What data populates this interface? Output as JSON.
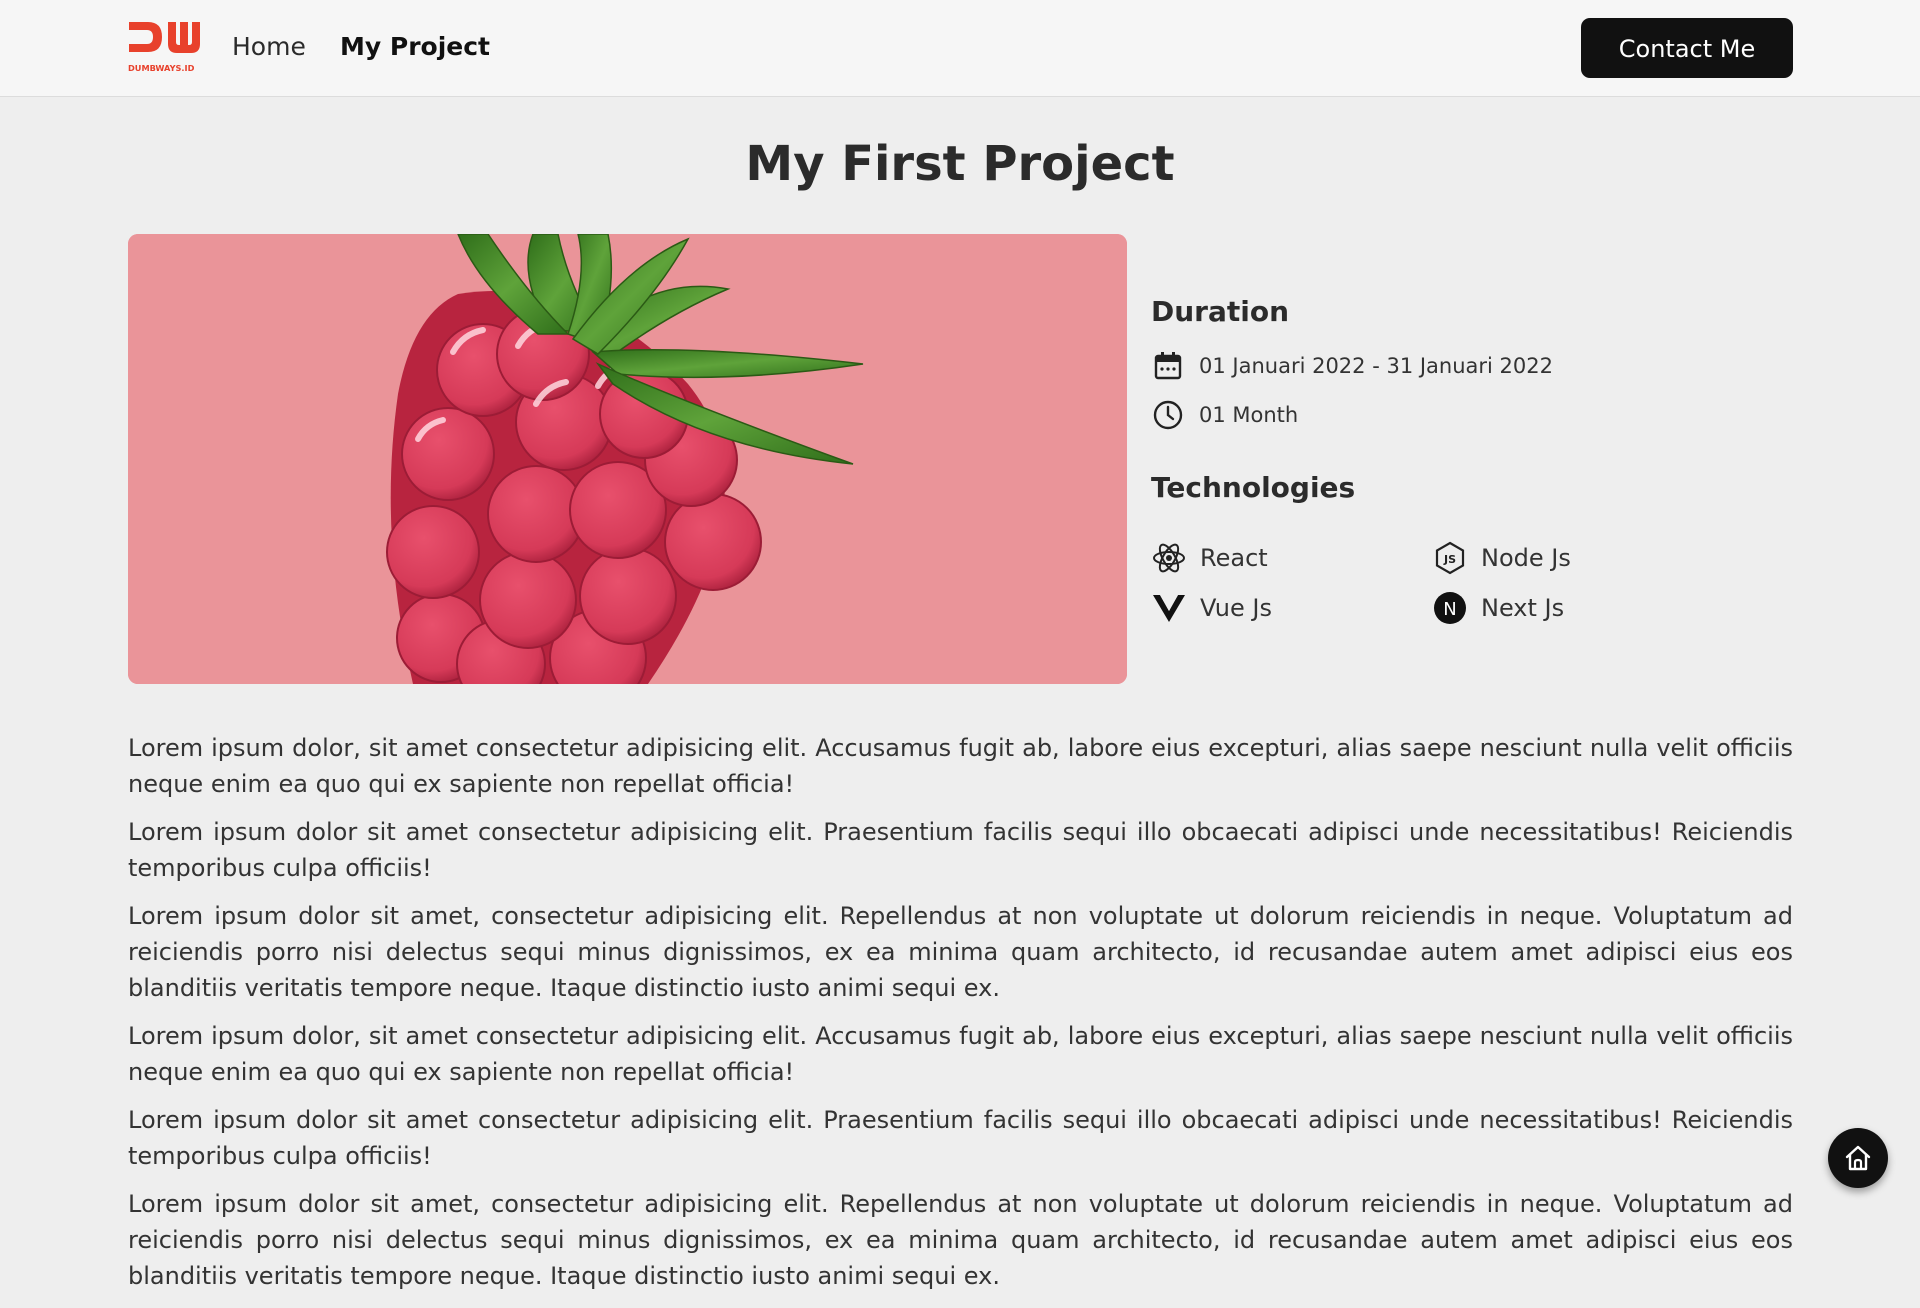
{
  "navbar": {
    "logo_text": "DUMBWAYS.ID",
    "links": [
      {
        "label": "Home",
        "active": false
      },
      {
        "label": "My Project",
        "active": true
      }
    ],
    "contact_button": "Contact Me"
  },
  "page": {
    "title": "My First Project"
  },
  "project": {
    "image": "raspberry-illustration",
    "duration_heading": "Duration",
    "date_range": "01 Januari 2022 - 31 Januari 2022",
    "length": "01 Month",
    "technologies_heading": "Technologies",
    "technologies": [
      {
        "name": "React",
        "icon": "react-icon"
      },
      {
        "name": "Node Js",
        "icon": "nodejs-icon"
      },
      {
        "name": "Vue Js",
        "icon": "vue-icon"
      },
      {
        "name": "Next Js",
        "icon": "nextjs-icon"
      }
    ]
  },
  "description": [
    "Lorem ipsum dolor, sit amet consectetur adipisicing elit. Accusamus fugit ab, labore eius excepturi, alias saepe nesciunt nulla velit officiis neque enim ea quo qui ex sapiente non repellat officia!",
    "Lorem ipsum dolor sit amet consectetur adipisicing elit. Praesentium facilis sequi illo obcaecati adipisci unde necessitatibus! Reiciendis temporibus culpa officiis!",
    "Lorem ipsum dolor sit amet, consectetur adipisicing elit. Repellendus at non voluptate ut dolorum reiciendis in neque. Voluptatum ad reiciendis porro nisi delectus sequi minus dignissimos, ex ea minima quam architecto, id recusandae autem amet adipisci eius eos blanditiis veritatis tempore neque. Itaque distinctio iusto animi sequi ex.",
    "Lorem ipsum dolor, sit amet consectetur adipisicing elit. Accusamus fugit ab, labore eius excepturi, alias saepe nesciunt nulla velit officiis neque enim ea quo qui ex sapiente non repellat officia!",
    "Lorem ipsum dolor sit amet consectetur adipisicing elit. Praesentium facilis sequi illo obcaecati adipisci unde necessitatibus! Reiciendis temporibus culpa officiis!",
    "Lorem ipsum dolor sit amet, consectetur adipisicing elit. Repellendus at non voluptate ut dolorum reiciendis in neque. Voluptatum ad reiciendis porro nisi delectus sequi minus dignissimos, ex ea minima quam architecto, id recusandae autem amet adipisci eius eos blanditiis veritatis tempore neque. Itaque distinctio iusto animi sequi ex."
  ],
  "fab": {
    "icon": "home-icon"
  },
  "colors": {
    "brand": "#e8412c",
    "button_bg": "#111111",
    "page_bg": "#eeeeee",
    "image_bg": "#ea9499"
  }
}
